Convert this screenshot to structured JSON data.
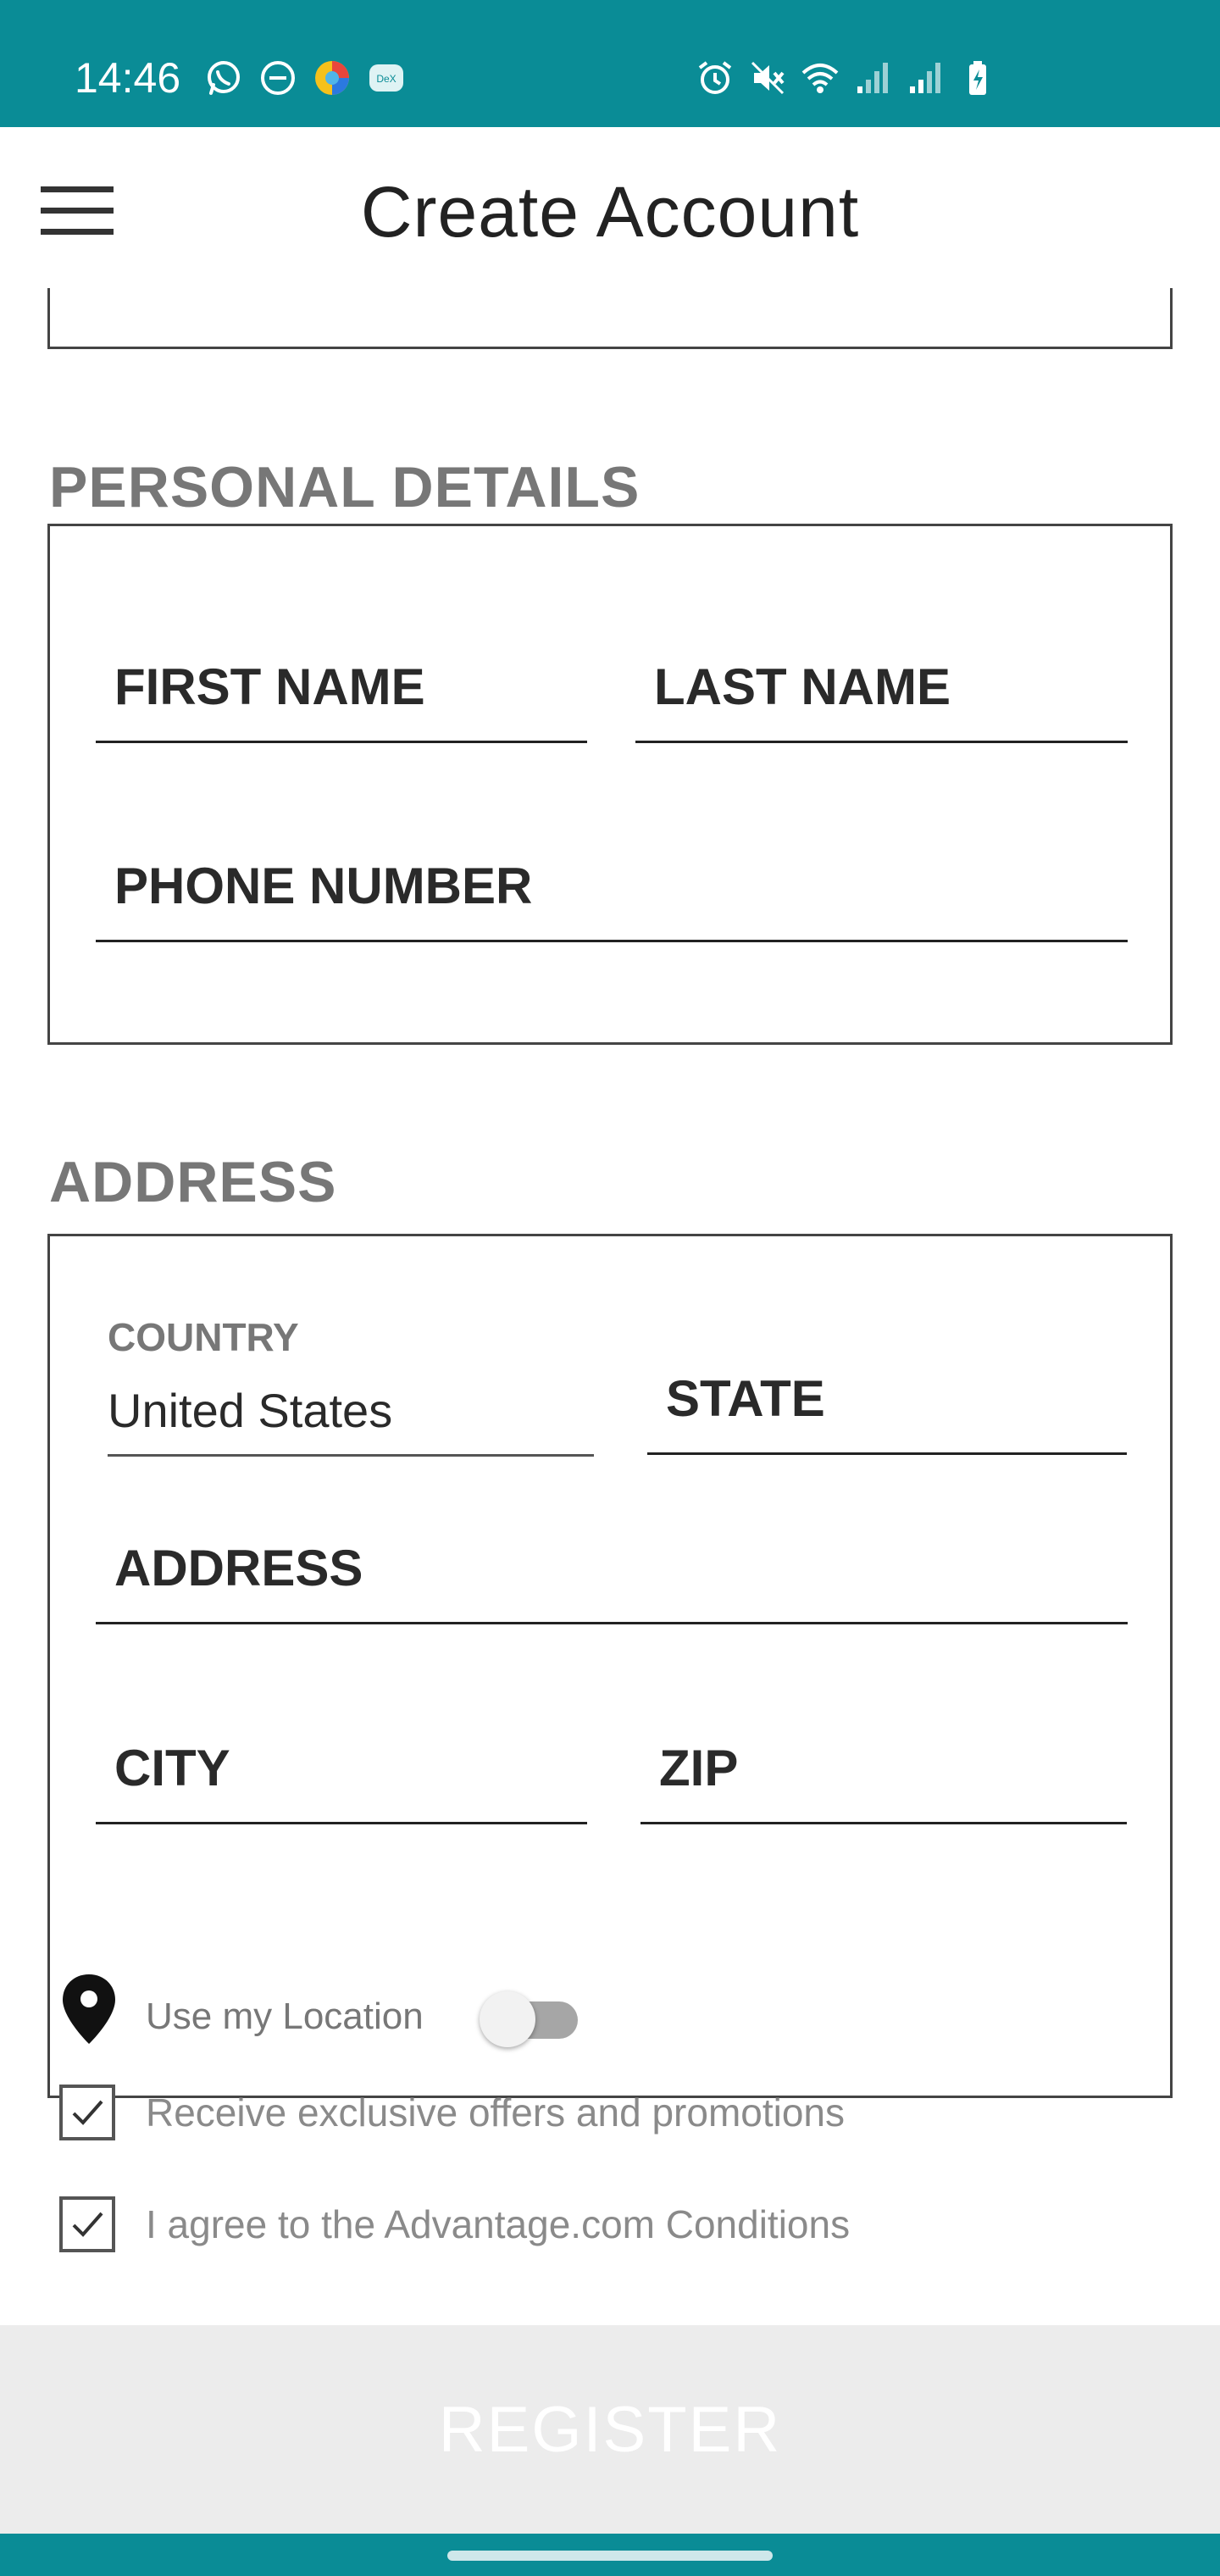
{
  "status_bar": {
    "time": "14:46",
    "left_icons": [
      "whatsapp-icon",
      "do-not-disturb-icon",
      "browser-icon",
      "dex-icon"
    ],
    "right_icons": [
      "alarm-icon",
      "mute-icon",
      "wifi-icon",
      "signal-icon",
      "signal-icon-2",
      "battery-charging-icon"
    ],
    "dex_label": "DeX",
    "color": "#0a8c96"
  },
  "header": {
    "title": "Create Account",
    "menu_icon": "hamburger-menu-icon"
  },
  "personal_details": {
    "section_title": "PERSONAL DETAILS",
    "first_name_placeholder": "FIRST NAME",
    "last_name_placeholder": "LAST NAME",
    "phone_placeholder": "PHONE NUMBER"
  },
  "address": {
    "section_title": "ADDRESS",
    "country_label": "COUNTRY",
    "country_value": "United States",
    "state_placeholder": "STATE",
    "address_placeholder": "ADDRESS",
    "city_placeholder": "CITY",
    "zip_placeholder": "ZIP"
  },
  "options": {
    "location_label": "Use my Location",
    "location_enabled": false,
    "offers_label": "Receive exclusive offers and promotions",
    "offers_checked": true,
    "conditions_label": "I agree to the Advantage.com Conditions",
    "conditions_checked": true
  },
  "register": {
    "label": "REGISTER",
    "enabled": false
  }
}
